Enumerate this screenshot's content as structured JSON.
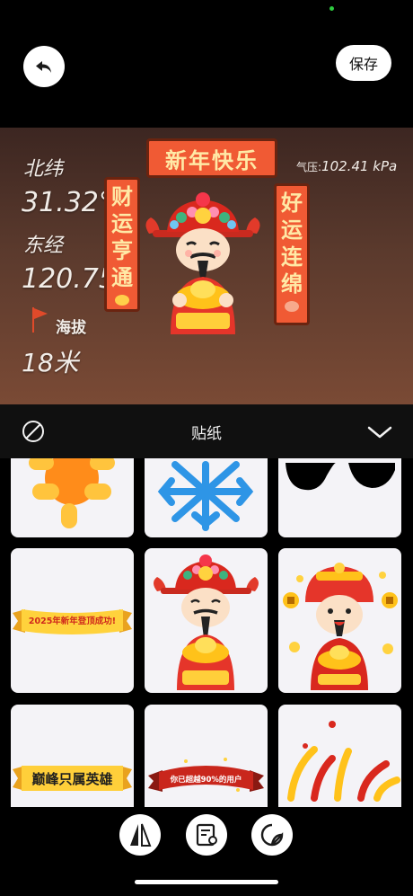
{
  "header": {
    "save_label": "保存"
  },
  "watermark": {
    "lat_label": "北纬",
    "lat_value": "31.32°",
    "lon_label": "东经",
    "lon_value": "120.75°",
    "altitude_label": "海拔",
    "altitude_value": "18米",
    "pressure_label": "气压:",
    "pressure_value": "102.41 kPa"
  },
  "sticker_on_photo": {
    "top_banner": "新年快乐",
    "left_banner": [
      "财",
      "运",
      "亨",
      "通"
    ],
    "right_banner": [
      "好",
      "运",
      "连",
      "绵"
    ]
  },
  "sheet": {
    "title": "贴纸"
  },
  "stickers": [
    {
      "name": "sun",
      "text": ""
    },
    {
      "name": "snowflake",
      "text": ""
    },
    {
      "name": "black-shape",
      "text": ""
    },
    {
      "name": "new-year-ribbon",
      "text": "2025年新年登顶成功!"
    },
    {
      "name": "god-of-wealth-gold",
      "text": ""
    },
    {
      "name": "god-of-wealth-coins",
      "text": ""
    },
    {
      "name": "peak-hero-ribbon",
      "text": "巅峰只属英雄"
    },
    {
      "name": "surpassed-ribbon",
      "text": "你已超越90%的用户"
    },
    {
      "name": "fireworks",
      "text": ""
    }
  ],
  "icons": {
    "back": "undo-arrow-icon",
    "disabled": "prohibit-icon",
    "collapse": "chevron-down-icon",
    "tools": [
      "mirror-icon",
      "template-edit-icon",
      "sticker-icon"
    ]
  },
  "colors": {
    "banner_red": "#f05a34",
    "banner_text": "#ffe9a6",
    "sheet_bg": "#101010"
  }
}
